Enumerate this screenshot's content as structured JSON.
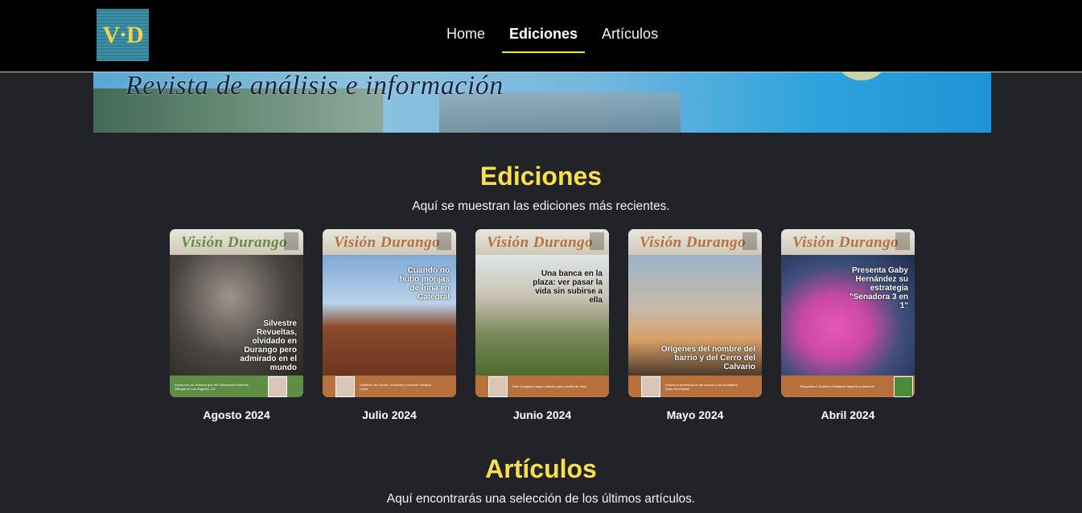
{
  "brand": {
    "logo_text": "V·D"
  },
  "nav": {
    "items": [
      {
        "label": "Home",
        "active": false
      },
      {
        "label": "Ediciones",
        "active": true
      },
      {
        "label": "Artículos",
        "active": false
      }
    ]
  },
  "banner": {
    "text": "Revista de análisis e información"
  },
  "editions_section": {
    "title": "Ediciones",
    "subtitle": "Aquí se muestran las ediciones más recientes.",
    "items": [
      {
        "label": "Agosto 2024",
        "masthead": "Visión Durango",
        "accent": "#6a9a4a",
        "headline": "Silvestre Revueltas, olvidado en Durango pero admirado en el mundo",
        "footer": "Acoso con un derecho gris del Gobernador Esteban Villegas en Los Ángeles, CA"
      },
      {
        "label": "Julio 2024",
        "masthead": "Visión Durango",
        "accent": "#b8713c",
        "headline": "Cuando no hubo monjas de luna en Catedral",
        "footer": "Gobierno de Gómez, ancianos y humano. Ricardo López"
      },
      {
        "label": "Junio 2024",
        "masthead": "Visión Durango",
        "accent": "#b8713c",
        "headline": "Una banca en la plaza: ver pasar la vida sin subirse a ella",
        "footer": "Pide Congreso mayor subsidio para cerrilla de Vejol"
      },
      {
        "label": "Mayo 2024",
        "masthead": "Visión Durango",
        "accent": "#b8713c",
        "headline": "Orígenes del nombre del barrio y del Cerro del Calvario",
        "footer": "Somos la presencia de las causas y los resultados. Gaby Hernández"
      },
      {
        "label": "Abril 2024",
        "masthead": "Visión Durango",
        "accent": "#b8713c",
        "headline": "Presenta Gaby Hernández su estrategia \"Senadora 3 en 1\"",
        "footer": "Respalda el Gobierno Estatal el deporte profesional"
      }
    ]
  },
  "articles_section": {
    "title": "Artículos",
    "subtitle": "Aquí encontrarás una selección de los últimos artículos."
  }
}
